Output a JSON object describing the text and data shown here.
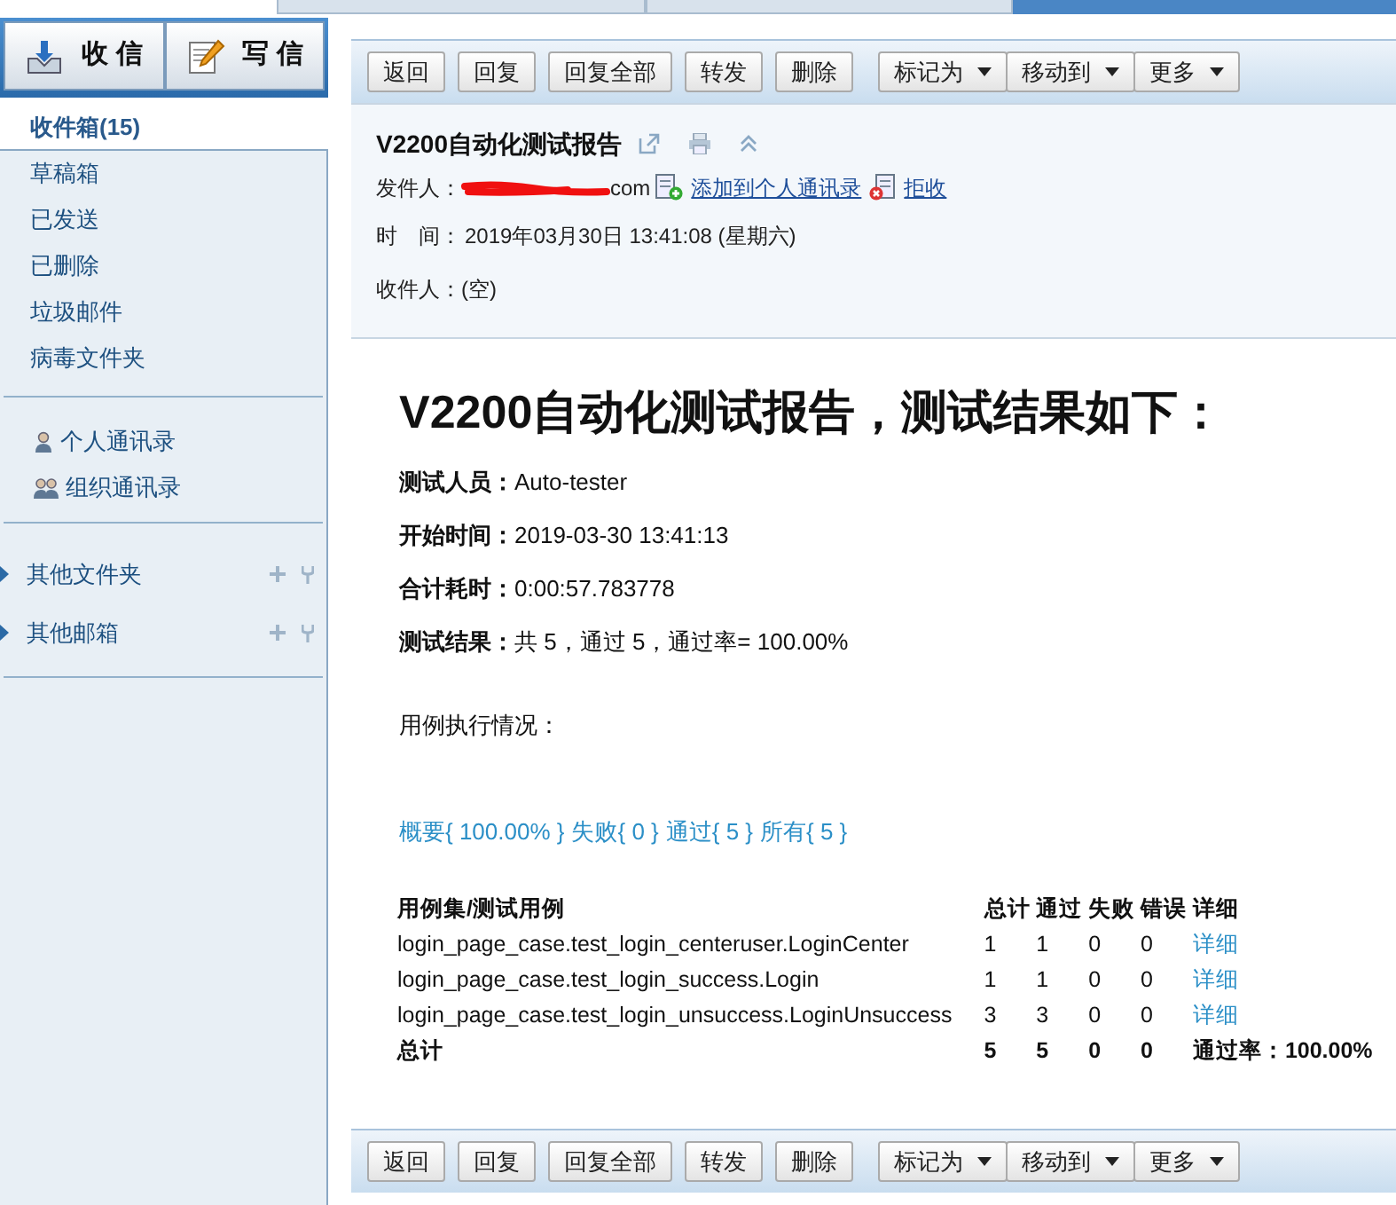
{
  "top_buttons": [
    {
      "kind": "receive",
      "label": "收 信"
    },
    {
      "kind": "compose",
      "label": "写 信"
    }
  ],
  "folders": [
    {
      "label": "收件箱(15)",
      "selected": true
    },
    {
      "label": "草稿箱",
      "selected": false
    },
    {
      "label": "已发送",
      "selected": false
    },
    {
      "label": "已删除",
      "selected": false
    },
    {
      "label": "垃圾邮件",
      "selected": false
    },
    {
      "label": "病毒文件夹",
      "selected": false
    }
  ],
  "contacts": [
    {
      "kind": "person",
      "label": "个人通讯录"
    },
    {
      "kind": "group",
      "label": "组织通讯录"
    }
  ],
  "sections": [
    {
      "label": "其他文件夹",
      "expanded": false
    },
    {
      "label": "其他邮箱",
      "expanded": false
    }
  ],
  "browser_tabs": [
    {
      "selected": false
    },
    {
      "selected": false
    },
    {
      "selected": true
    }
  ],
  "top_toolbar": [
    {
      "label": "返回",
      "dropdown": false
    },
    {
      "label": "回复",
      "dropdown": false
    },
    {
      "label": "回复全部",
      "dropdown": false
    },
    {
      "label": "转发",
      "dropdown": false
    },
    {
      "label": "删除",
      "dropdown": false
    },
    {
      "label": "标记为",
      "dropdown": true
    },
    {
      "label": "移动到",
      "dropdown": true
    },
    {
      "label": "更多",
      "dropdown": true
    }
  ],
  "bottom_toolbar": [
    {
      "label": "返回",
      "dropdown": false
    },
    {
      "label": "回复",
      "dropdown": false
    },
    {
      "label": "回复全部",
      "dropdown": false
    },
    {
      "label": "转发",
      "dropdown": false
    },
    {
      "label": "删除",
      "dropdown": false
    },
    {
      "label": "标记为",
      "dropdown": true
    },
    {
      "label": "移动到",
      "dropdown": true
    },
    {
      "label": "更多",
      "dropdown": true
    }
  ],
  "email": {
    "subject": "V2200自动化测试报告",
    "from_label": "发件人：",
    "from_visible": "com",
    "add_contact": "添加到个人通讯录",
    "reject": "拒收",
    "time_label": "时　间：",
    "time": "2019年03月30日 13:41:08 (星期六)",
    "to_label": "收件人：",
    "to": "(空)"
  },
  "report": {
    "heading": "V2200自动化测试报告，测试结果如下：",
    "facts": [
      {
        "label": "测试人员：",
        "value": "Auto-tester"
      },
      {
        "label": "开始时间：",
        "value": "2019-03-30 13:41:13"
      },
      {
        "label": "合计耗时：",
        "value": "0:00:57.783778"
      },
      {
        "label": "测试结果：",
        "value": "共 5，通过 5，通过率= 100.00%"
      }
    ],
    "cases_title": "用例执行情况：",
    "filters": [
      "概要{ 100.00% }",
      "失败{ 0 }",
      "通过{ 5 }",
      "所有{ 5 }"
    ],
    "columns": [
      "用例集/测试用例",
      "总计",
      "通过",
      "失败",
      "错误",
      "详细"
    ],
    "rows": [
      {
        "name": "login_page_case.test_login_centeruser.LoginCenter",
        "total": "1",
        "pass": "1",
        "fail": "0",
        "error": "0",
        "detail": "详细"
      },
      {
        "name": "login_page_case.test_login_success.Login",
        "total": "1",
        "pass": "1",
        "fail": "0",
        "error": "0",
        "detail": "详细"
      },
      {
        "name": "login_page_case.test_login_unsuccess.LoginUnsuccess",
        "total": "3",
        "pass": "3",
        "fail": "0",
        "error": "0",
        "detail": "详细"
      }
    ],
    "total_row": {
      "name": "总计",
      "total": "5",
      "pass": "5",
      "fail": "0",
      "error": "0",
      "rate": "通过率：100.00%"
    }
  }
}
